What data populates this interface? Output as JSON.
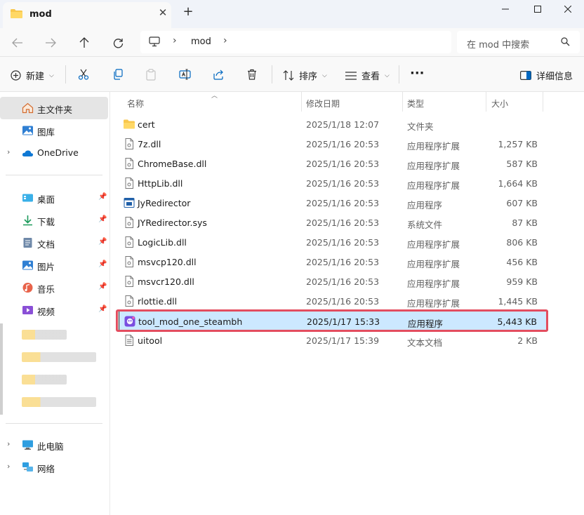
{
  "window": {
    "tab_title": "mod",
    "new_tab_label": "+"
  },
  "address": {
    "path": "mod",
    "search_placeholder": "在 mod 中搜索"
  },
  "toolbar": {
    "new_label": "新建",
    "sort_label": "排序",
    "view_label": "查看",
    "more_label": "···",
    "details_label": "详细信息"
  },
  "sidebar": {
    "home": "主文件夹",
    "gallery": "图库",
    "onedrive": "OneDrive",
    "quick": [
      {
        "label": "桌面",
        "icon": "desktop-icon"
      },
      {
        "label": "下载",
        "icon": "download-icon"
      },
      {
        "label": "文档",
        "icon": "documents-icon"
      },
      {
        "label": "图片",
        "icon": "pictures-icon"
      },
      {
        "label": "音乐",
        "icon": "music-icon"
      },
      {
        "label": "视频",
        "icon": "videos-icon"
      }
    ],
    "this_pc": "此电脑",
    "network": "网络"
  },
  "columns": {
    "name": "名称",
    "modified": "修改日期",
    "type": "类型",
    "size": "大小"
  },
  "files": [
    {
      "name": "cert",
      "date": "2025/1/18 12:07",
      "type": "文件夹",
      "size": "",
      "icon": "folder-icon"
    },
    {
      "name": "7z.dll",
      "date": "2025/1/16 20:53",
      "type": "应用程序扩展",
      "size": "1,257 KB",
      "icon": "dll-icon"
    },
    {
      "name": "ChromeBase.dll",
      "date": "2025/1/16 20:53",
      "type": "应用程序扩展",
      "size": "587 KB",
      "icon": "dll-icon"
    },
    {
      "name": "HttpLib.dll",
      "date": "2025/1/16 20:53",
      "type": "应用程序扩展",
      "size": "1,664 KB",
      "icon": "dll-icon"
    },
    {
      "name": "JyRedirector",
      "date": "2025/1/16 20:53",
      "type": "应用程序",
      "size": "607 KB",
      "icon": "exe-icon"
    },
    {
      "name": "JYRedirector.sys",
      "date": "2025/1/16 20:53",
      "type": "系统文件",
      "size": "87 KB",
      "icon": "sys-icon"
    },
    {
      "name": "LogicLib.dll",
      "date": "2025/1/16 20:53",
      "type": "应用程序扩展",
      "size": "806 KB",
      "icon": "dll-icon"
    },
    {
      "name": "msvcp120.dll",
      "date": "2025/1/16 20:53",
      "type": "应用程序扩展",
      "size": "456 KB",
      "icon": "dll-icon"
    },
    {
      "name": "msvcr120.dll",
      "date": "2025/1/16 20:53",
      "type": "应用程序扩展",
      "size": "959 KB",
      "icon": "dll-icon"
    },
    {
      "name": "rlottie.dll",
      "date": "2025/1/16 20:53",
      "type": "应用程序扩展",
      "size": "1,445 KB",
      "icon": "dll-icon"
    },
    {
      "name": "tool_mod_one_steambh",
      "date": "2025/1/17 15:33",
      "type": "应用程序",
      "size": "5,443 KB",
      "icon": "app-icon",
      "selected": true
    },
    {
      "name": "uitool",
      "date": "2025/1/17 15:39",
      "type": "文本文档",
      "size": "2 KB",
      "icon": "text-file-icon"
    }
  ],
  "colors": {
    "selection": "#cce8ff",
    "highlight_box": "#e34d5f",
    "folder": "#f8c74d",
    "accent": "#0067c0"
  }
}
